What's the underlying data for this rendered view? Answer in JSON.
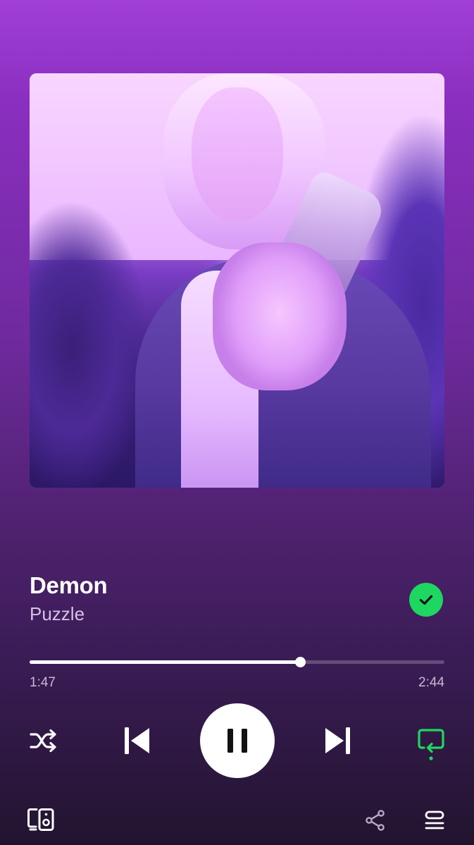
{
  "track": {
    "title": "Demon",
    "artist": "Puzzle",
    "liked": true
  },
  "progress": {
    "elapsed": "1:47",
    "total": "2:44",
    "fraction": 0.652
  },
  "controls": {
    "shuffle_icon": "shuffle-icon",
    "previous_icon": "skip-previous-icon",
    "play_pause_icon": "pause-icon",
    "next_icon": "skip-next-icon",
    "repeat_icon": "repeat-icon",
    "repeat_active": true
  },
  "footer": {
    "devices_icon": "connect-device-icon",
    "share_icon": "share-icon",
    "queue_icon": "queue-icon"
  },
  "colors": {
    "accent": "#1ed760",
    "background_top": "#a13fd6",
    "background_bottom": "#22142f"
  }
}
